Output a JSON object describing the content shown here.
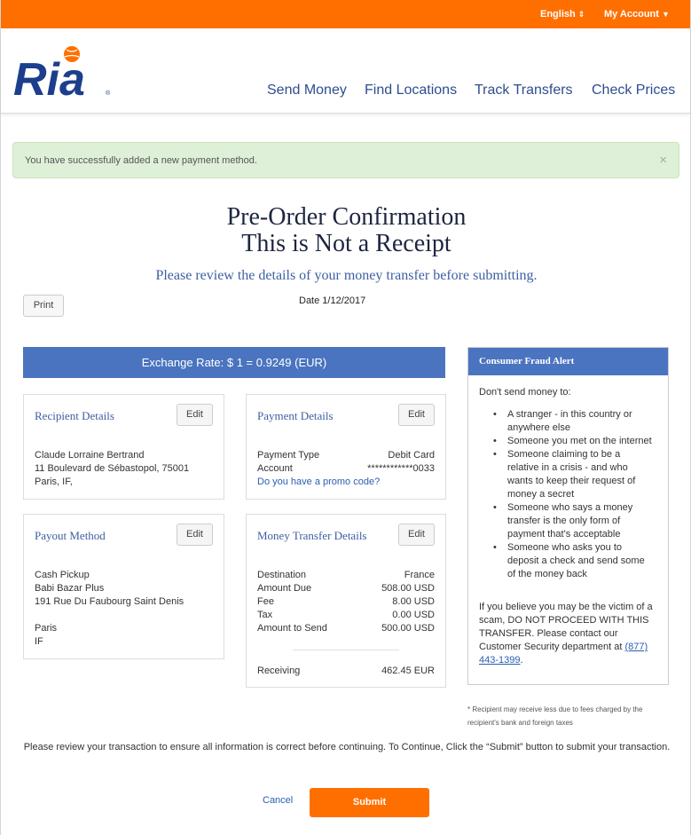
{
  "topbar": {
    "language": "English",
    "account": "My Account",
    "accent_color": "#ff6f00"
  },
  "brand": {
    "logo_text": "Ria",
    "logo_color": "#1c3e8c",
    "ball_color": "#ff6f00"
  },
  "nav": {
    "items": [
      "Send Money",
      "Find Locations",
      "Track Transfers",
      "Check Prices"
    ]
  },
  "notice": {
    "message": "You have successfully added a new payment method.",
    "close": "×"
  },
  "heading": {
    "line1": "Pre-Order Confirmation",
    "line2": "This is Not a Receipt",
    "subtitle": "Please review the details of your money transfer before submitting."
  },
  "print_label": "Print",
  "date_text": "Date 1/12/2017",
  "exchange_rate": "Exchange Rate: $ 1 = 0.9249 (EUR)",
  "recipient": {
    "title": "Recipient Details",
    "edit": "Edit",
    "lines": [
      "Claude Lorraine Bertrand",
      "11 Boulevard de Sébastopol, 75001",
      "Paris, IF,"
    ]
  },
  "payment": {
    "title": "Payment Details",
    "edit": "Edit",
    "type_label": "Payment Type",
    "type_value": "Debit Card",
    "account_label": "Account",
    "account_value": "************0033",
    "promo_link": "Do you have a promo code?"
  },
  "payout": {
    "title": "Payout Method",
    "edit": "Edit",
    "lines": [
      "Cash Pickup",
      "Babi Bazar Plus",
      "191 Rue Du Faubourg Saint Denis",
      "",
      "Paris",
      "IF"
    ]
  },
  "transfer": {
    "title": "Money Transfer Details",
    "edit": "Edit",
    "rows": [
      {
        "label": "Destination",
        "value": "France"
      },
      {
        "label": "Amount Due",
        "value": "508.00 USD"
      },
      {
        "label": "Fee",
        "value": "8.00 USD"
      },
      {
        "label": "Tax",
        "value": "0.00 USD"
      },
      {
        "label": "Amount to Send",
        "value": "500.00 USD"
      }
    ],
    "receiving_label": "Receiving",
    "receiving_value": "462.45 EUR"
  },
  "fraud": {
    "title": "Consumer Fraud Alert",
    "intro": "Don't send money to:",
    "items": [
      "A stranger - in this country or anywhere else",
      "Someone you met on the internet",
      "Someone claiming to be a relative in a crisis - and who wants to keep their request of money a secret",
      "Someone who says a money transfer is the only form of payment that's acceptable",
      "Someone who asks you to deposit a check and send some of the money back"
    ],
    "paragraph": "If you believe you may be the victim of a scam, DO NOT PROCEED WITH THIS TRANSFER. Please contact our Customer Security department at",
    "phone": "(877) 443-1399",
    "period": "."
  },
  "footnote": "* Recipient may receive less due to fees charged by the recipient's bank and foreign taxes",
  "review_text": "Please review your transaction to ensure all information is correct before continuing. To Continue, Click the “Submit” button to submit your transaction.",
  "actions": {
    "cancel": "Cancel",
    "submit": "Submit"
  }
}
